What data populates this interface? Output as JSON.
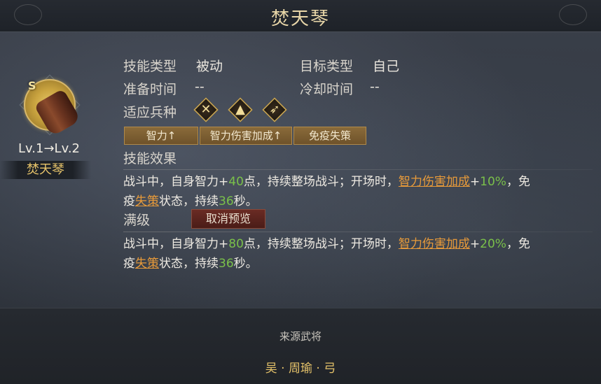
{
  "title": "焚天琴",
  "item": {
    "grade": "S",
    "icon": "zither-icon",
    "level_text": "Lv.1→Lv.2",
    "name": "焚天琴"
  },
  "info": {
    "skill_type_label": "技能类型",
    "skill_type_value": "被动",
    "target_type_label": "目标类型",
    "target_type_value": "自己",
    "prep_time_label": "准备时间",
    "prep_time_value": "--",
    "cooldown_label": "冷却时间",
    "cooldown_value": "--",
    "troop_label": "适应兵种",
    "troops": [
      {
        "name": "spear-troop-icon",
        "glyph": "✕"
      },
      {
        "name": "cavalry-troop-icon",
        "glyph": "▲"
      },
      {
        "name": "bow-troop-icon",
        "glyph": "➶"
      }
    ]
  },
  "tags": [
    "智力↑",
    "智力伤害加成↑",
    "免疫失策"
  ],
  "effect": {
    "title": "技能效果",
    "line1_a": "战斗中，自身智力+",
    "line1_num": "40",
    "line1_b": "点，持续整场战斗；开场时，",
    "line1_link": "智力伤害加成",
    "line1_c": "+",
    "line1_pct": "10%",
    "line1_d": "，免",
    "line2_a": "疫",
    "line2_link": "失策",
    "line2_b": "状态，持续",
    "line2_num": "36",
    "line2_c": "秒。"
  },
  "max_level": {
    "title": "满级",
    "cancel_preview": "取消预览",
    "line1_a": "战斗中，自身智力+",
    "line1_num": "80",
    "line1_b": "点，持续整场战斗；开场时，",
    "line1_link": "智力伤害加成",
    "line1_c": "+",
    "line1_pct": "20%",
    "line1_d": "，免",
    "line2_a": "疫",
    "line2_link": "失策",
    "line2_b": "状态，持续",
    "line2_num": "36",
    "line2_c": "秒。"
  },
  "source": {
    "label": "来源武将",
    "general": "吴 · 周瑜 · 弓"
  },
  "colors": {
    "gold": "#e6c36a",
    "green": "#7ac04a",
    "link": "#e79a3a",
    "cancel_button": "#5a2420"
  }
}
